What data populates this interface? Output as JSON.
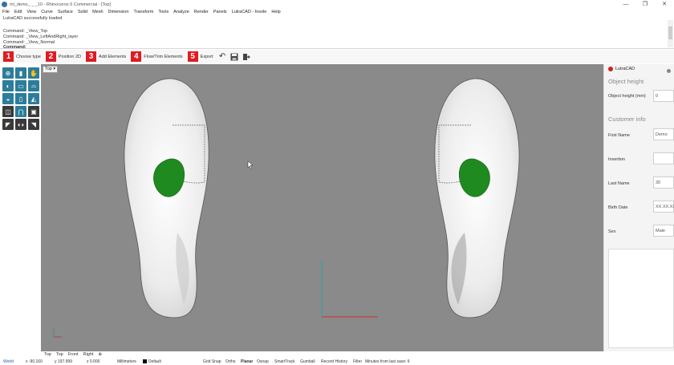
{
  "window": {
    "title": "ml_demo_ _ _10 - Rhinoceros 6 Commercial - [Top]",
    "controls": [
      "—",
      "❐",
      "✕"
    ]
  },
  "menu": [
    "File",
    "Edit",
    "View",
    "Curve",
    "Surface",
    "Solid",
    "Mesh",
    "Dimension",
    "Transform",
    "Tools",
    "Analyze",
    "Render",
    "Panels",
    "LutraCAD - Insole",
    "Help"
  ],
  "command_history": [
    "LutraCAD successfully loaded",
    "",
    "Command: _View_Top",
    "Command: _View_LeftAndRight_layer",
    "Command: _View_Normal",
    "Command:"
  ],
  "steps": [
    {
      "num": "1",
      "label": "Choose type"
    },
    {
      "num": "2",
      "label": "Position 2D"
    },
    {
      "num": "3",
      "label": "Add Elements"
    },
    {
      "num": "4",
      "label": "Flow/Trim Elements"
    },
    {
      "num": "5",
      "label": "Export"
    }
  ],
  "toolbar_icons": [
    "undo-icon",
    "save-icon",
    "exit-icon"
  ],
  "left_icons": [
    "mirror-foot-icon",
    "foot-left-icon",
    "hand-icon",
    "foot-outline-icon",
    "sole-icon",
    "arch-icon",
    "heel-icon",
    "metatarsal-icon",
    "toe-icon",
    "box-icon",
    "foot-front-icon",
    "image-icon",
    "foot-side-icon",
    "feet-pair-icon",
    "foot-back-icon"
  ],
  "viewport": {
    "label": "Top",
    "colors": {
      "background": "#8a8a8a",
      "pad": "#1f8a1f",
      "insole": "#f2f2f2"
    }
  },
  "right_panel": {
    "brand": "LutraCAD",
    "section_object": "Object height",
    "object_height_label": "Object height (mm)",
    "object_height_value": "0",
    "section_customer": "Customer info",
    "first_name_label": "First Name",
    "first_name_value": "Demo",
    "insertion_label": "Insertion",
    "insertion_value": "",
    "last_name_label": "Last Name",
    "last_name_value": "30",
    "birth_date_label": "Birth Date",
    "birth_date_value": "XX.XX.XXXX",
    "sex_label": "Sex",
    "sex_value": "Male"
  },
  "viewport_tabs": [
    "Top",
    "Top",
    "Front",
    "Right",
    "⊕"
  ],
  "status": {
    "cplane": "World",
    "x": "x -90.160",
    "y": "y 197.999",
    "z": "z 0.000",
    "units": "Millimeters",
    "layer": "Default",
    "grid_snap": "Grid Snap",
    "ortho": "Ortho",
    "planar": "Planar",
    "osnap": "Osnap",
    "smarttrack": "SmartTrack",
    "gumball": "Gumball",
    "record_history": "Record History",
    "filter": "Filter",
    "save_info": "Minutes from last save: 6"
  }
}
